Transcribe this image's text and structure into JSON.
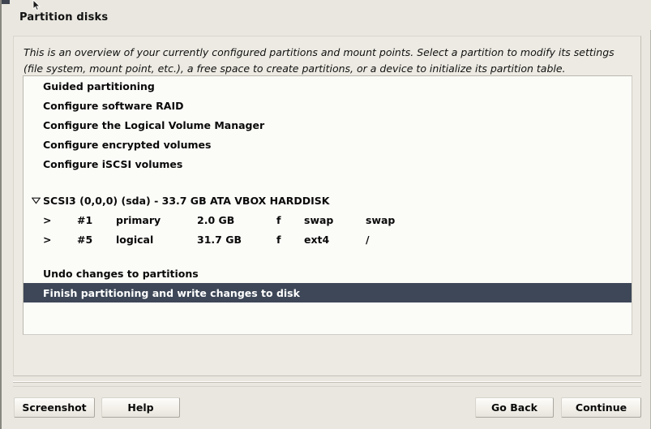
{
  "window": {
    "title": "Partition disks"
  },
  "description": {
    "line1": "This is an overview of your currently configured partitions and mount points. Select a partition to modify its settings",
    "line2": "(file system, mount point, etc.), a free space to create partitions, or a device to initialize its partition table."
  },
  "colors": {
    "selection": "#3d4757",
    "window_background": "#e9e7df",
    "list_background": "#fbfbf8",
    "panel_background": "#eceae2"
  },
  "menu_items": [
    {
      "label": "Guided partitioning"
    },
    {
      "label": "Configure software RAID"
    },
    {
      "label": "Configure the Logical Volume Manager"
    },
    {
      "label": "Configure encrypted volumes"
    },
    {
      "label": "Configure iSCSI volumes"
    }
  ],
  "device": {
    "expander_icon": "triangle-down-icon",
    "label": "SCSI3 (0,0,0) (sda) - 33.7 GB ATA VBOX HARDDISK"
  },
  "partitions": [
    {
      "arrow": ">",
      "number": "#1",
      "type": "primary",
      "size": "2.0 GB",
      "flags": "f",
      "filesystem": "swap",
      "mountpoint": "swap"
    },
    {
      "arrow": ">",
      "number": "#5",
      "type": "logical",
      "size": "31.7 GB",
      "flags": "f",
      "filesystem": "ext4",
      "mountpoint": "/"
    }
  ],
  "actions": [
    {
      "label": "Undo changes to partitions",
      "selected": false
    },
    {
      "label": "Finish partitioning and write changes to disk",
      "selected": true
    }
  ],
  "buttons": {
    "screenshot": "Screenshot",
    "help": "Help",
    "go_back": "Go Back",
    "continue": "Continue"
  }
}
